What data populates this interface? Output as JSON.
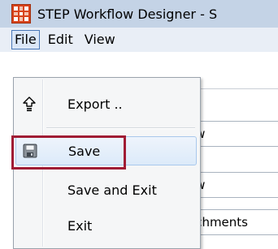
{
  "window": {
    "title": "STEP Workflow Designer - S",
    "app_icon": "step-logo-icon"
  },
  "menubar": {
    "items": [
      "File",
      "Edit",
      "View"
    ],
    "active": "File"
  },
  "background_fields": [
    "ow",
    "ow",
    "achments"
  ],
  "file_menu": {
    "items": [
      {
        "label": "Export ..",
        "icon": "export-icon"
      },
      {
        "label": "Save",
        "icon": "floppy-disk-icon"
      },
      {
        "label": "Save and Exit",
        "icon": ""
      },
      {
        "label": "Exit",
        "icon": ""
      }
    ],
    "hovered": "Save"
  },
  "colors": {
    "titlebar": "#c4d3e6",
    "menubar": "#e9eef6",
    "highlight_box": "#a01c34",
    "app_icon": "#d8431b"
  }
}
